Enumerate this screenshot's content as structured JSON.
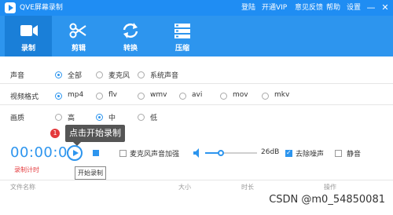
{
  "app": {
    "title": "QVE屏幕录制"
  },
  "titlebar": {
    "links": [
      "登陆",
      "开通VIP",
      "意见反馈",
      "帮助",
      "设置"
    ],
    "minimize": "—",
    "close": "✕"
  },
  "toolbar": {
    "tools": [
      {
        "label": "录制",
        "icon": "video-camera-icon",
        "active": true
      },
      {
        "label": "剪辑",
        "icon": "scissors-icon",
        "active": false
      },
      {
        "label": "转换",
        "icon": "convert-arrows-icon",
        "active": false
      },
      {
        "label": "压缩",
        "icon": "compress-icon",
        "active": false
      }
    ]
  },
  "settings": {
    "audio": {
      "label": "声音",
      "options": [
        "全部",
        "麦克风",
        "系统声音"
      ],
      "selected": "全部"
    },
    "format": {
      "label": "视频格式",
      "options": [
        "mp4",
        "flv",
        "wmv",
        "avi",
        "mov",
        "mkv"
      ],
      "selected": "mp4"
    },
    "quality": {
      "label": "画质",
      "options": [
        "高",
        "中",
        "低"
      ],
      "selected": "中"
    }
  },
  "tooltip": {
    "badge": "1",
    "text": "点击开始录制"
  },
  "controls": {
    "timer": "00:00:00",
    "timer_label": "录制计时",
    "play_tooltip": "开始录制",
    "mic_boost": "麦克风声音加强",
    "volume": "26dB",
    "volume_level": 0.3,
    "noise_reduction": "去除噪声",
    "mute": "静音"
  },
  "table": {
    "headers": [
      "文件名称",
      "大小",
      "时长",
      "操作"
    ]
  },
  "watermark": "CSDN @m0_54850081",
  "colors": {
    "accent": "#2d95ee",
    "titlebar": "#1f8df3",
    "danger": "#e4393c"
  }
}
